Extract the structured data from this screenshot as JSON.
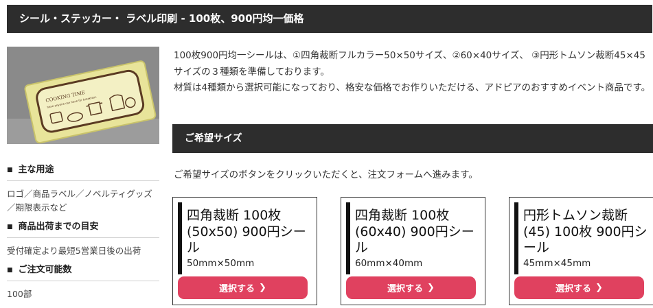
{
  "header": {
    "title": "シール・ステッカー・ ラベル印刷 - 100枚、900円均一価格"
  },
  "image_text": {
    "line1": "COOKING TIME",
    "line2": "have anyone can have for breakfast."
  },
  "sidebar": {
    "sections": [
      {
        "heading": "主な用途",
        "text": "ロゴ／商品ラベル／ノベルティグッズ／期限表示など"
      },
      {
        "heading": "商品出荷までの目安",
        "text": "受付確定より最短5営業日後の出荷"
      },
      {
        "heading": "ご注文可能数",
        "text": "100部"
      }
    ]
  },
  "intro": {
    "paragraph1": "100枚900円均一シールは、①四角裁断フルカラー50×50サイズ、②60×40サイズ、 ③円形トムソン裁断45×45サイズの３種類を準備しております。",
    "paragraph2": "材質は4種類から選択可能になっており、格安な価格でお作りいただける、アドピアのおすすめイベント商品です。"
  },
  "size_section": {
    "heading": "ご希望サイズ",
    "guide": "ご希望サイズのボタンをクリックいただくと、注文フォームへ進みます。",
    "cards": [
      {
        "title": "四角裁断 100枚(50x50) 900円シール",
        "size": "50mm×50mm",
        "button": "選択する"
      },
      {
        "title": "四角裁断 100枚(60x40) 900円シール",
        "size": "60mm×40mm",
        "button": "選択する"
      },
      {
        "title": "円形トムソン裁断(45) 100枚 900円シール",
        "size": "45mm×45mm",
        "button": "選択する"
      }
    ]
  },
  "colors": {
    "header_bg": "#2d2d2d",
    "button": "#e0415f",
    "sticker": "#e8e49a"
  },
  "icons": {
    "bullet": "square-bullet-icon",
    "button_arrow": "chevron-right-icon"
  }
}
